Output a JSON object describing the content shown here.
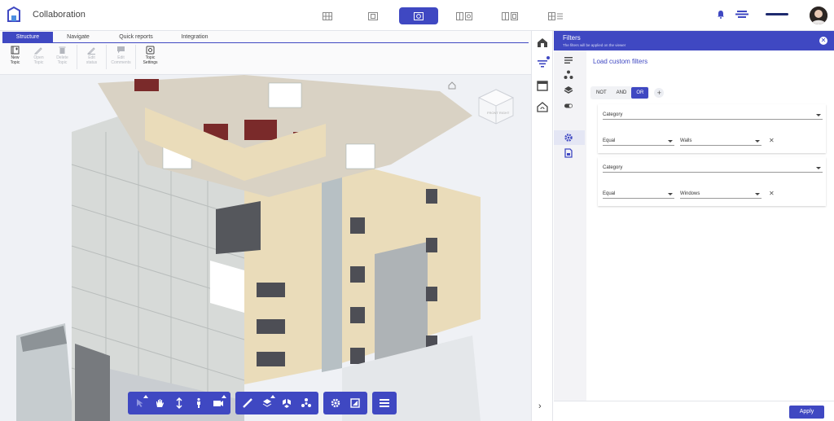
{
  "app": {
    "title": "Collaboration"
  },
  "viewmodes": [
    {
      "name": "grid-view",
      "active": false
    },
    {
      "name": "model-view",
      "active": false
    },
    {
      "name": "model-3d-view",
      "active": true
    },
    {
      "name": "split-view",
      "active": false
    },
    {
      "name": "compare-view",
      "active": false
    },
    {
      "name": "table-view",
      "active": false
    }
  ],
  "ribbon": {
    "tabs": [
      "Structure",
      "Navigate",
      "Quick reports",
      "Integration"
    ],
    "active_tab": "Structure",
    "tools": [
      {
        "label": "New\nTopic",
        "icon": "new-topic-icon",
        "enabled": true
      },
      {
        "label": "Open\nTopic",
        "icon": "open-topic-icon",
        "enabled": false
      },
      {
        "label": "Delete\nTopic",
        "icon": "delete-topic-icon",
        "enabled": false
      },
      {
        "label": "Edit\nstatus",
        "icon": "edit-status-icon",
        "enabled": false
      },
      {
        "label": "Edit\nComments",
        "icon": "comments-icon",
        "enabled": false
      },
      {
        "label": "Topic\nSettings",
        "icon": "settings-icon",
        "enabled": true
      }
    ]
  },
  "viewer": {
    "navcube_label": "FRONT RIGHT",
    "bottom_toolbar": [
      [
        "select-icon",
        "pan-icon",
        "zoom-icon",
        "walk-icon",
        "camera-icon"
      ],
      [
        "measure-icon",
        "section-icon",
        "explode-icon",
        "model-browser-icon"
      ],
      [
        "settings-icon",
        "fullscreen-icon"
      ],
      [
        "properties-icon"
      ]
    ]
  },
  "side_strip": [
    "home-icon",
    "filter-icon",
    "calendar-icon",
    "sync-icon"
  ],
  "panel": {
    "title": "Filters",
    "subtitle": "The filters will be applied on the viewer",
    "load_label": "Load custom filters",
    "sub_icons": [
      "list-icon",
      "hierarchy-icon",
      "layers-icon",
      "toggle-icon",
      "gear-filter-icon",
      "document-icon"
    ],
    "logic": {
      "options": [
        "NOT",
        "AND",
        "OR"
      ],
      "selected": "OR"
    },
    "filters": [
      {
        "field": "Category",
        "operator": "Equal",
        "value": "Walls"
      },
      {
        "field": "Category",
        "operator": "Equal",
        "value": "Windows"
      }
    ],
    "apply_label": "Apply"
  },
  "colors": {
    "accent": "#3f48c2",
    "facade": "#eadcba",
    "panel_bg": "#f3f3f6"
  }
}
